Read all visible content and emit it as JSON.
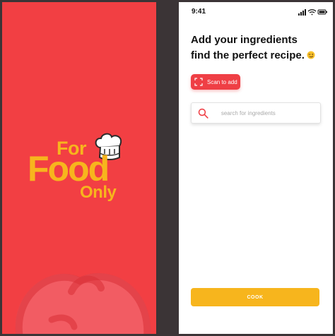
{
  "splash": {
    "logo": {
      "for": "For",
      "food": "Food",
      "only": "Only"
    },
    "colors": {
      "background": "#f23f43",
      "brand": "#f7b51d"
    }
  },
  "app": {
    "status_bar": {
      "time": "9:41",
      "icons": [
        "signal-icon",
        "wifi-icon",
        "battery-icon"
      ]
    },
    "headline": {
      "line1": "Add your ingredients",
      "line2": "find the perfect recipe."
    },
    "scan_button": {
      "label": "Scan to add",
      "icon": "scan-icon"
    },
    "search": {
      "placeholder": "search for ingredients",
      "value": "",
      "icon": "search-icon"
    },
    "cook_button": {
      "label": "COOK"
    },
    "colors": {
      "accent": "#ef3f45",
      "cook": "#f7b51d"
    }
  }
}
